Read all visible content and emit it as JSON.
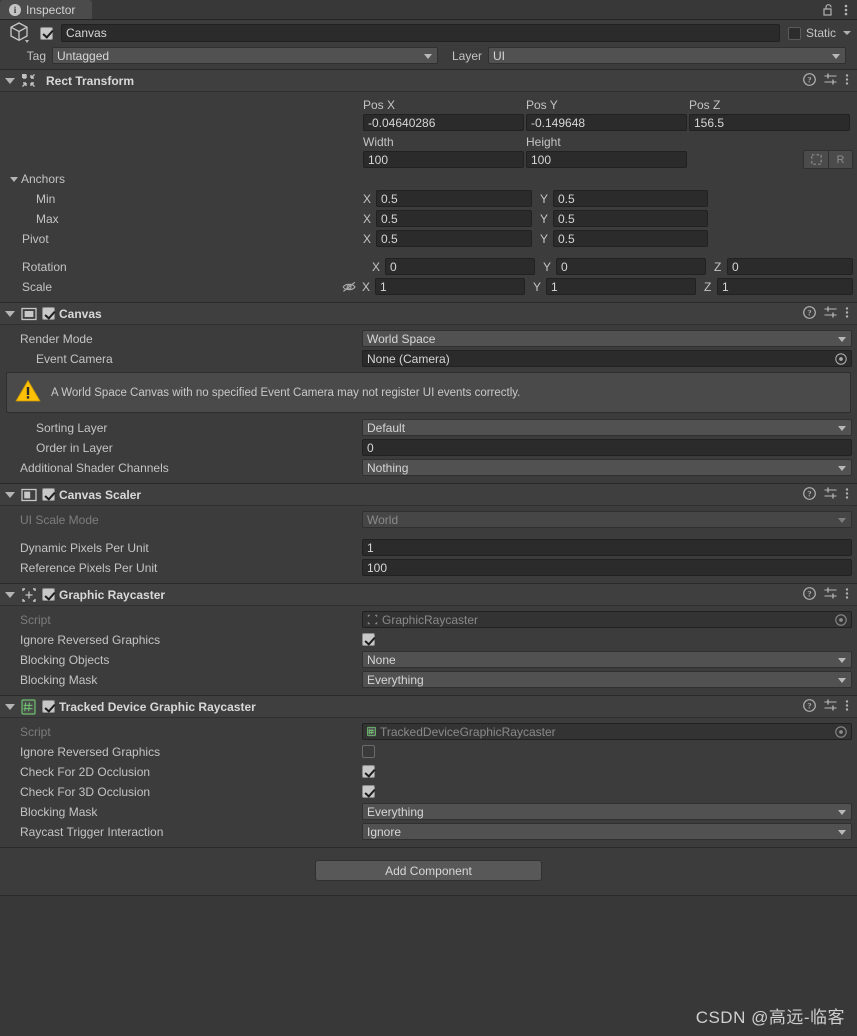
{
  "window": {
    "tab_label": "Inspector",
    "tab_icon": "info-icon",
    "lock_icon": "lock-open-icon",
    "menu_icon": "kebab-menu-icon"
  },
  "object_header": {
    "object_icon": "gameobject-cube-icon",
    "enabled": true,
    "name": "Canvas",
    "static_label": "Static",
    "static_checked": false,
    "tag_label": "Tag",
    "tag_value": "Untagged",
    "layer_label": "Layer",
    "layer_value": "UI"
  },
  "components": [
    {
      "id": "rect-transform",
      "title": "Rect Transform",
      "icon": "rect-transform-icon",
      "has_enable_checkbox": false,
      "enabled": true,
      "tools": [
        "help-icon",
        "preset-icon",
        "kebab-menu-icon"
      ],
      "pos_headers": [
        "Pos X",
        "Pos Y",
        "Pos Z"
      ],
      "pos_values": [
        "-0.04640286",
        "-0.149648",
        "156.5"
      ],
      "size_headers": [
        "Width",
        "Height"
      ],
      "size_values": [
        "100",
        "100"
      ],
      "blueprint_button": "blueprint-mode-icon",
      "raw_button": "R",
      "anchors_label": "Anchors",
      "anchor_rows": [
        {
          "label": "Min",
          "x_axis": "X",
          "x": "0.5",
          "y_axis": "Y",
          "y": "0.5"
        },
        {
          "label": "Max",
          "x_axis": "X",
          "x": "0.5",
          "y_axis": "Y",
          "y": "0.5"
        }
      ],
      "pivot_row": {
        "label": "Pivot",
        "x_axis": "X",
        "x": "0.5",
        "y_axis": "Y",
        "y": "0.5"
      },
      "rotation_row": {
        "label": "Rotation",
        "x_axis": "X",
        "x": "0",
        "y_axis": "Y",
        "y": "0",
        "z_axis": "Z",
        "z": "0"
      },
      "scale_row": {
        "label": "Scale",
        "icon": "eye-slash-icon",
        "x_axis": "X",
        "x": "1",
        "y_axis": "Y",
        "y": "1",
        "z_axis": "Z",
        "z": "1"
      }
    },
    {
      "id": "canvas",
      "title": "Canvas",
      "icon": "canvas-icon",
      "has_enable_checkbox": true,
      "enabled": true,
      "tools": [
        "help-icon",
        "preset-icon",
        "kebab-menu-icon"
      ],
      "fields": [
        {
          "type": "popup",
          "label": "Render Mode",
          "value": "World Space",
          "indent": 0
        },
        {
          "type": "object",
          "label": "Event Camera",
          "value": "None (Camera)",
          "indent": 1,
          "picker": "object-picker-icon"
        }
      ],
      "warning": {
        "icon": "warning-triangle-icon",
        "text": "A World Space Canvas with no specified Event Camera may not register UI events correctly."
      },
      "fields2": [
        {
          "type": "popup",
          "label": "Sorting Layer",
          "value": "Default",
          "indent": 1
        },
        {
          "type": "text",
          "label": "Order in Layer",
          "value": "0",
          "indent": 1
        },
        {
          "type": "popup",
          "label": "Additional Shader Channels",
          "value": "Nothing",
          "indent": 0
        }
      ]
    },
    {
      "id": "canvas-scaler",
      "title": "Canvas Scaler",
      "icon": "canvas-scaler-icon",
      "has_enable_checkbox": true,
      "enabled": true,
      "tools": [
        "help-icon",
        "preset-icon",
        "kebab-menu-icon"
      ],
      "fields": [
        {
          "type": "popup",
          "label": "UI Scale Mode",
          "value": "World",
          "indent": 0,
          "disabled": true
        },
        {
          "type": "text",
          "label": "Dynamic Pixels Per Unit",
          "value": "1",
          "indent": 0
        },
        {
          "type": "text",
          "label": "Reference Pixels Per Unit",
          "value": "100",
          "indent": 0
        }
      ]
    },
    {
      "id": "graphic-raycaster",
      "title": "Graphic Raycaster",
      "icon": "graphic-raycaster-icon",
      "has_enable_checkbox": true,
      "enabled": true,
      "tools": [
        "help-icon",
        "preset-icon",
        "kebab-menu-icon"
      ],
      "fields": [
        {
          "type": "script",
          "label": "Script",
          "value": "GraphicRaycaster",
          "icon": "script-ui-icon",
          "picker": "object-picker-icon",
          "disabled": true
        },
        {
          "type": "checkbox",
          "label": "Ignore Reversed Graphics",
          "checked": true
        },
        {
          "type": "popup",
          "label": "Blocking Objects",
          "value": "None"
        },
        {
          "type": "popup",
          "label": "Blocking Mask",
          "value": "Everything"
        }
      ]
    },
    {
      "id": "tracked-device-graphic-raycaster",
      "title": "Tracked Device Graphic Raycaster",
      "icon": "csharp-script-icon",
      "has_enable_checkbox": true,
      "enabled": true,
      "tools": [
        "help-icon",
        "preset-icon",
        "kebab-menu-icon"
      ],
      "fields": [
        {
          "type": "script",
          "label": "Script",
          "value": "TrackedDeviceGraphicRaycaster",
          "icon": "csharp-script-small-icon",
          "picker": "object-picker-icon",
          "disabled": true
        },
        {
          "type": "checkbox",
          "label": "Ignore Reversed Graphics",
          "checked": false
        },
        {
          "type": "checkbox",
          "label": "Check For 2D Occlusion",
          "checked": true
        },
        {
          "type": "checkbox",
          "label": "Check For 3D Occlusion",
          "checked": true
        },
        {
          "type": "popup",
          "label": "Blocking Mask",
          "value": "Everything"
        },
        {
          "type": "popup",
          "label": "Raycast Trigger Interaction",
          "value": "Ignore"
        }
      ]
    }
  ],
  "add_component": {
    "label": "Add Component"
  },
  "watermark": {
    "text": "CSDN @高远-临客"
  },
  "colors": {
    "background": "#383838",
    "panel": "#3c3c3c",
    "header": "#3f3f3f",
    "field": "#2b2b2b",
    "popup": "#515151",
    "text": "#c4c4c4",
    "text_dim": "#7d7d7d",
    "warning": "#ffc107",
    "script_green": "#6ec06e"
  }
}
